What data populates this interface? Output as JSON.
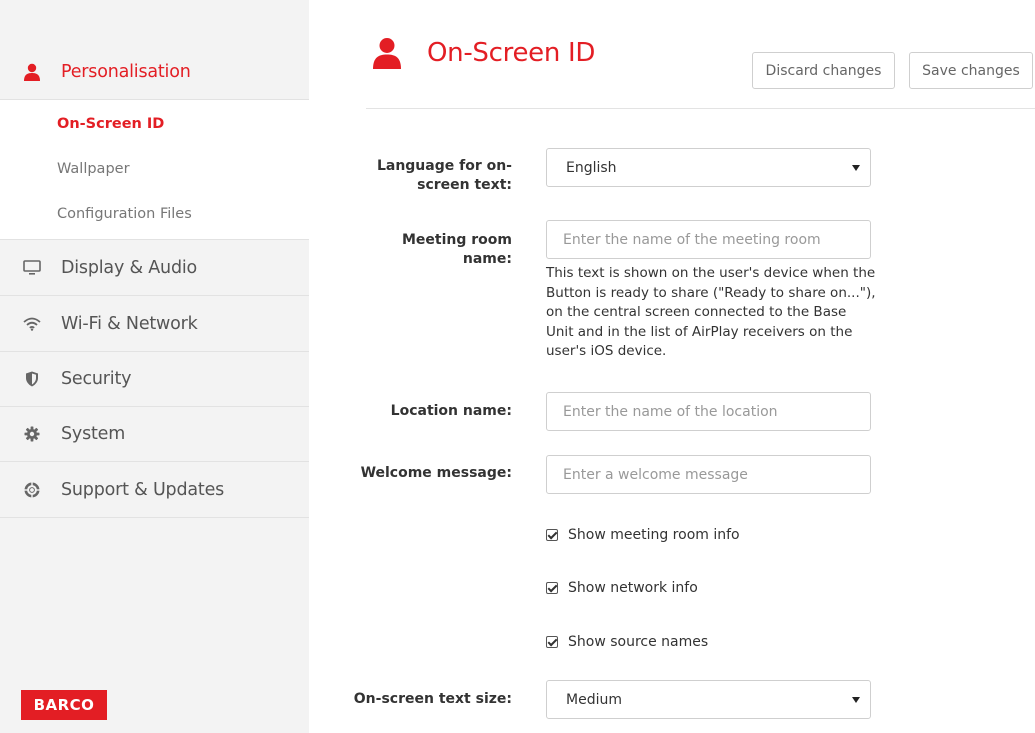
{
  "sidebar": {
    "sections": [
      {
        "label": "Personalisation",
        "icon": "user-icon",
        "active": true
      },
      {
        "label": "Display & Audio",
        "icon": "monitor-icon"
      },
      {
        "label": "Wi-Fi & Network",
        "icon": "wifi-icon"
      },
      {
        "label": "Security",
        "icon": "shield-icon"
      },
      {
        "label": "System",
        "icon": "gear-icon"
      },
      {
        "label": "Support & Updates",
        "icon": "lifebuoy-icon"
      }
    ],
    "sub_items": [
      {
        "label": "On-Screen ID",
        "active": true
      },
      {
        "label": "Wallpaper"
      },
      {
        "label": "Configuration Files"
      }
    ],
    "logo_text": "BARCO"
  },
  "header": {
    "title": "On-Screen ID",
    "discard_label": "Discard changes",
    "save_label": "Save changes"
  },
  "form": {
    "language": {
      "label": "Language for on-screen text:",
      "value": "English"
    },
    "meeting_room": {
      "label": "Meeting room name:",
      "placeholder": "Enter the name of the meeting room",
      "help": "This text is shown on the user's device when the Button is ready to share (\"Ready to share on...\"), on the central screen connected to the Base Unit and in the list of AirPlay receivers on the user's iOS device."
    },
    "location": {
      "label": "Location name:",
      "placeholder": "Enter the name of the location"
    },
    "welcome": {
      "label": "Welcome message:",
      "placeholder": "Enter a welcome message"
    },
    "checkboxes": [
      {
        "label": "Show meeting room info",
        "checked": true
      },
      {
        "label": "Show network info",
        "checked": true
      },
      {
        "label": "Show source names",
        "checked": true
      }
    ],
    "text_size": {
      "label": "On-screen text size:",
      "value": "Medium"
    }
  },
  "colors": {
    "accent": "#e31e24",
    "sidebar_bg": "#f3f3f3"
  }
}
